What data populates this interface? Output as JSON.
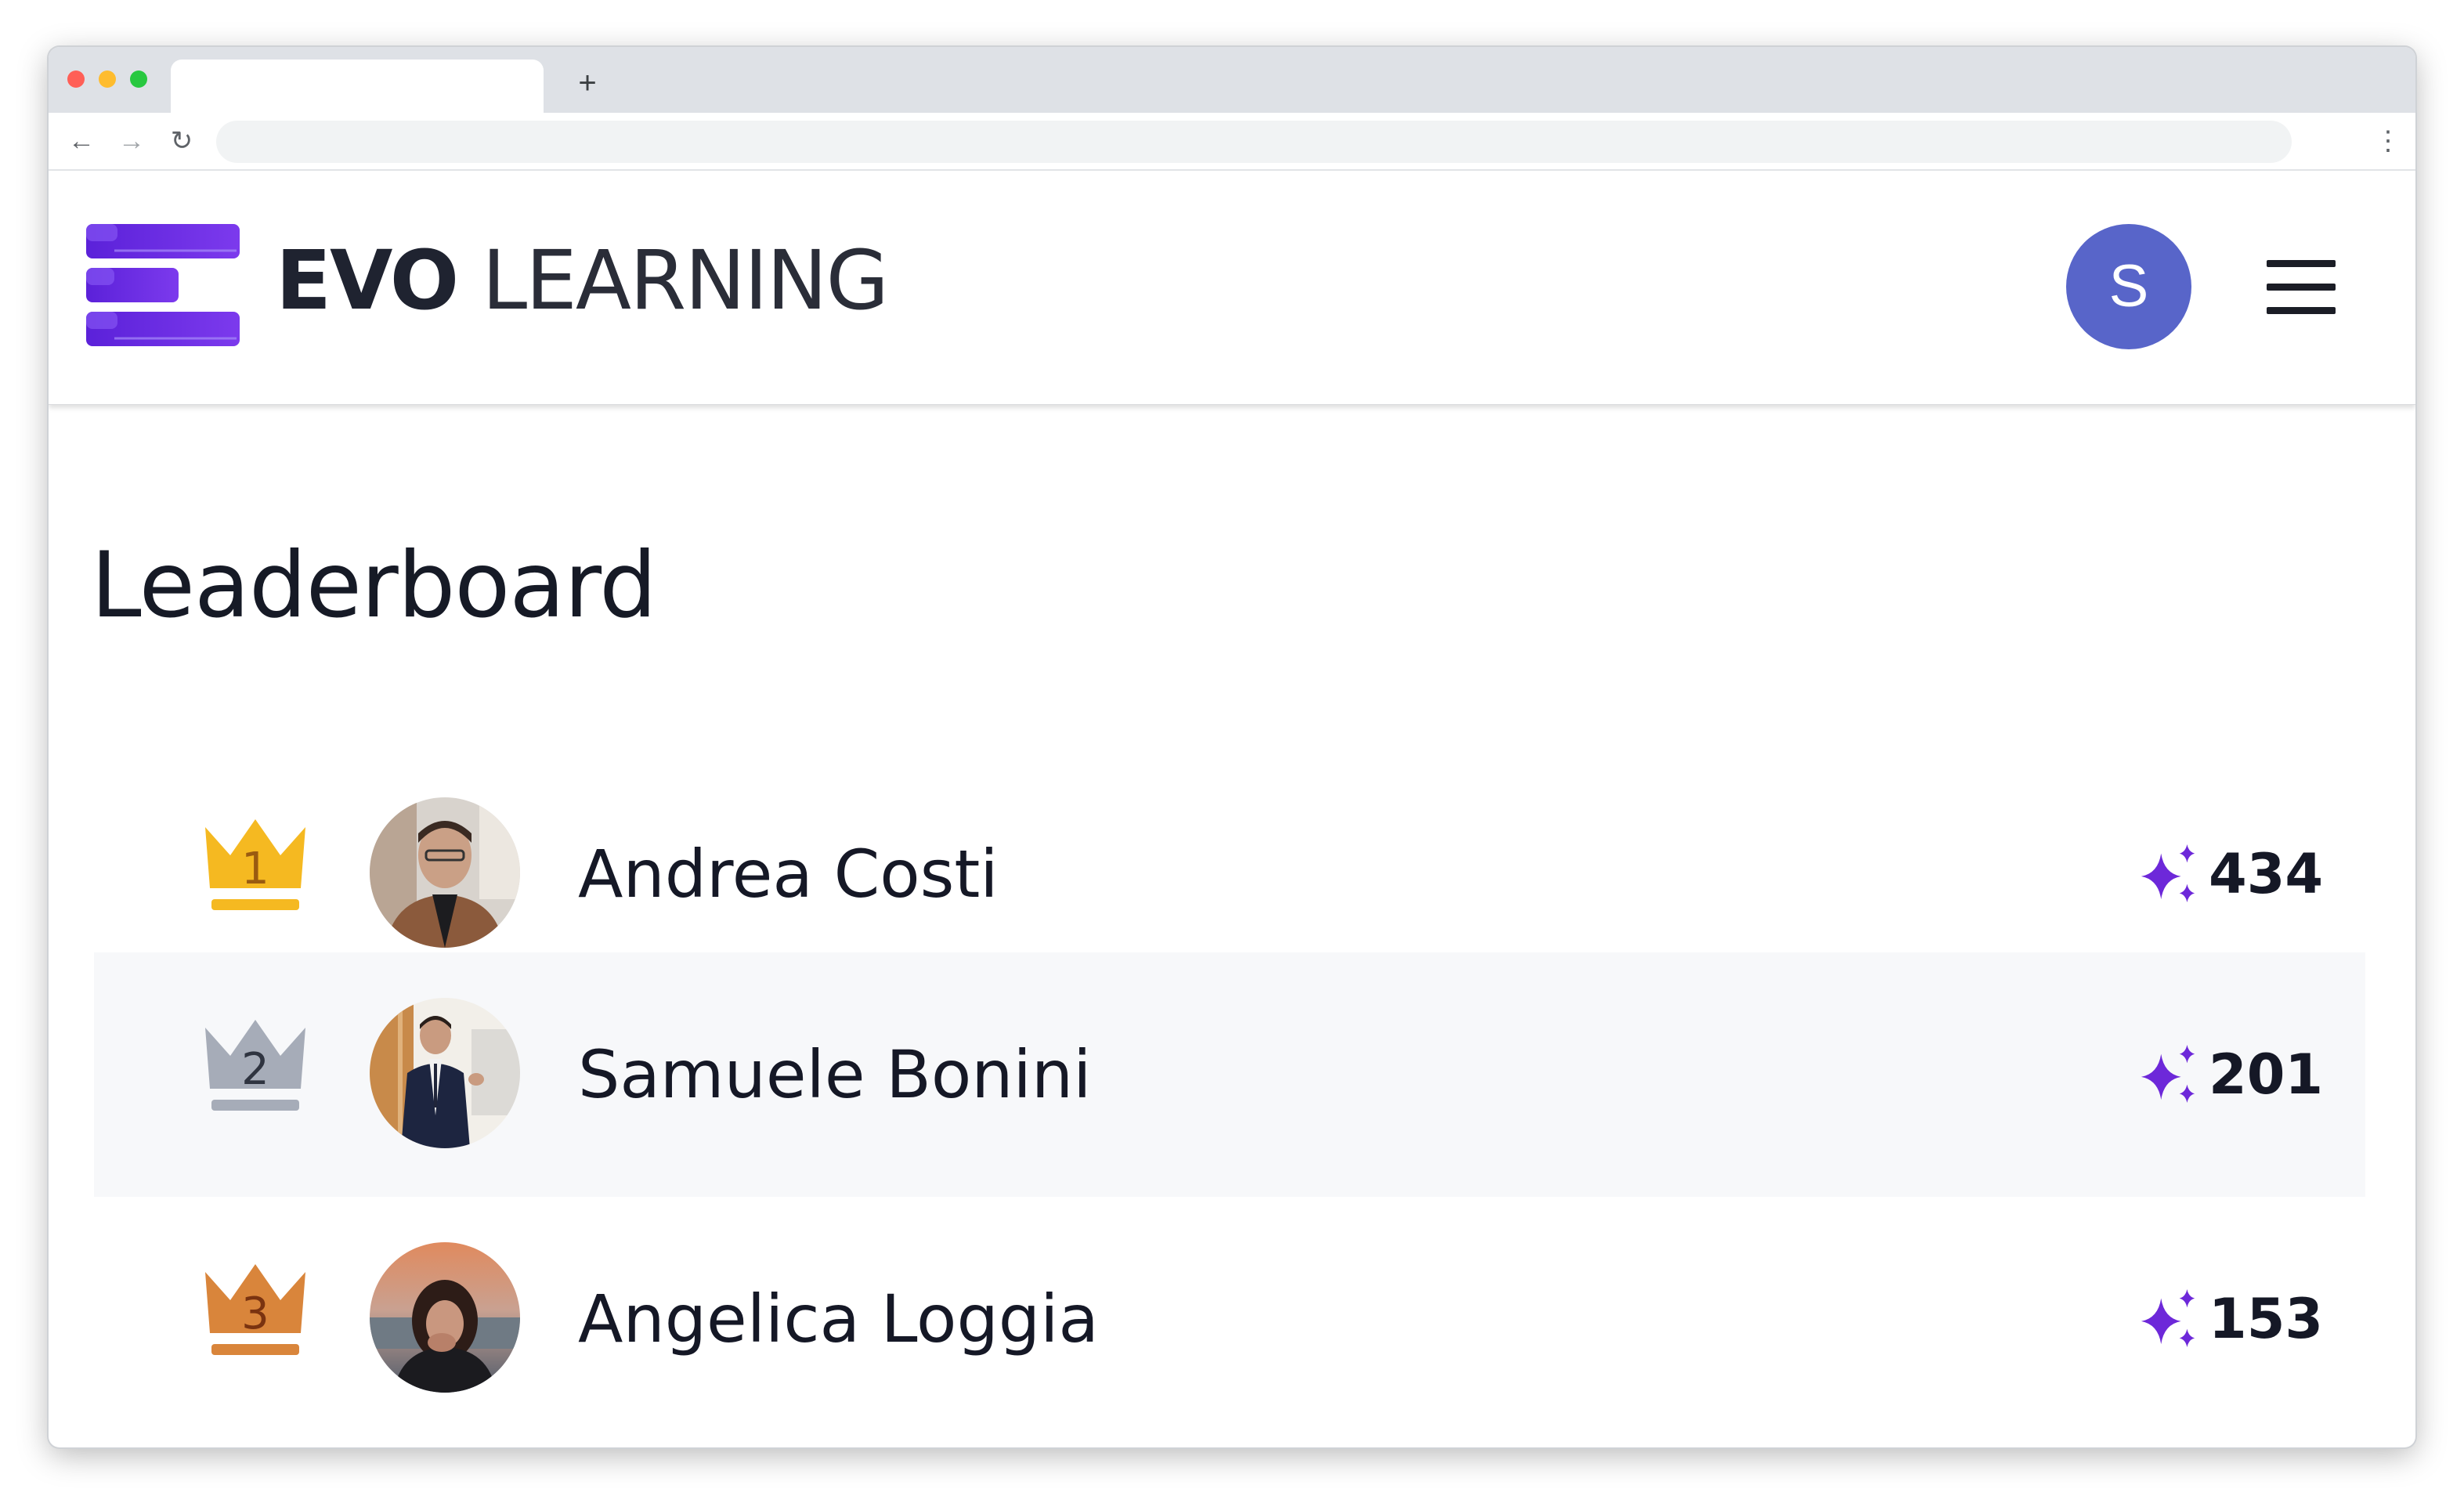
{
  "browser": {
    "new_tab_label": "+",
    "back_icon": "arrow-left-icon",
    "forward_icon": "arrow-right-icon",
    "reload_icon": "reload-icon",
    "menu_icon": "kebab-icon"
  },
  "header": {
    "brand_bold": "EVO",
    "brand_light": "LEARNING",
    "user_initial": "S",
    "accent_color": "#5865c9",
    "logo_color": "#6d28d9"
  },
  "page": {
    "title": "Leaderboard"
  },
  "leaderboard": [
    {
      "rank": "1",
      "name": "Andrea Costi",
      "score": "434",
      "crown_color": "#f5b921"
    },
    {
      "rank": "2",
      "name": "Samuele Bonini",
      "score": "201",
      "crown_color": "#a6acb8"
    },
    {
      "rank": "3",
      "name": "Angelica Loggia",
      "score": "153",
      "crown_color": "#d9853b"
    }
  ]
}
